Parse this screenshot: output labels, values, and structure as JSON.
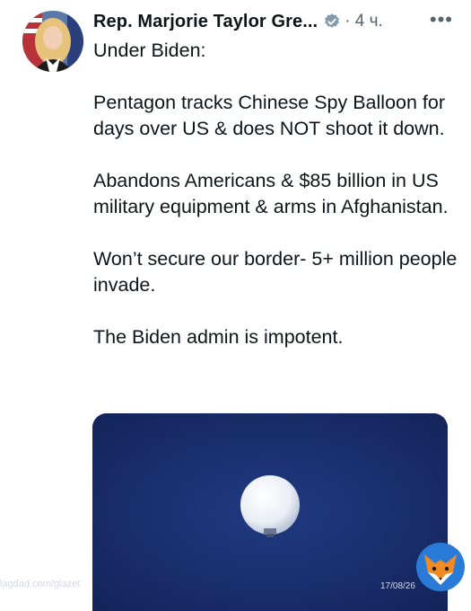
{
  "author": {
    "display_name": "Rep. Marjorie Taylor Gre...",
    "verified_icon": "verified-badge-icon",
    "timestamp": "· 4 ч."
  },
  "more_icon": "more-options-icon",
  "tweet": {
    "lines": [
      "Under Biden:",
      "Pentagon tracks Chinese Spy Balloon for days over US & does NOT shoot it down.",
      "Abandons Americans & $85 billion in US military equipment & arms in Afghanistan.",
      "Won’t secure our border- 5+ million people invade.",
      "The Biden admin is impotent."
    ]
  },
  "media": {
    "icon": "balloon-photo",
    "sky_color": "#162a63"
  },
  "watermark": {
    "source": "lagdad.com/glazet",
    "date": "17/08/26",
    "logo": "fox-logo-icon"
  }
}
